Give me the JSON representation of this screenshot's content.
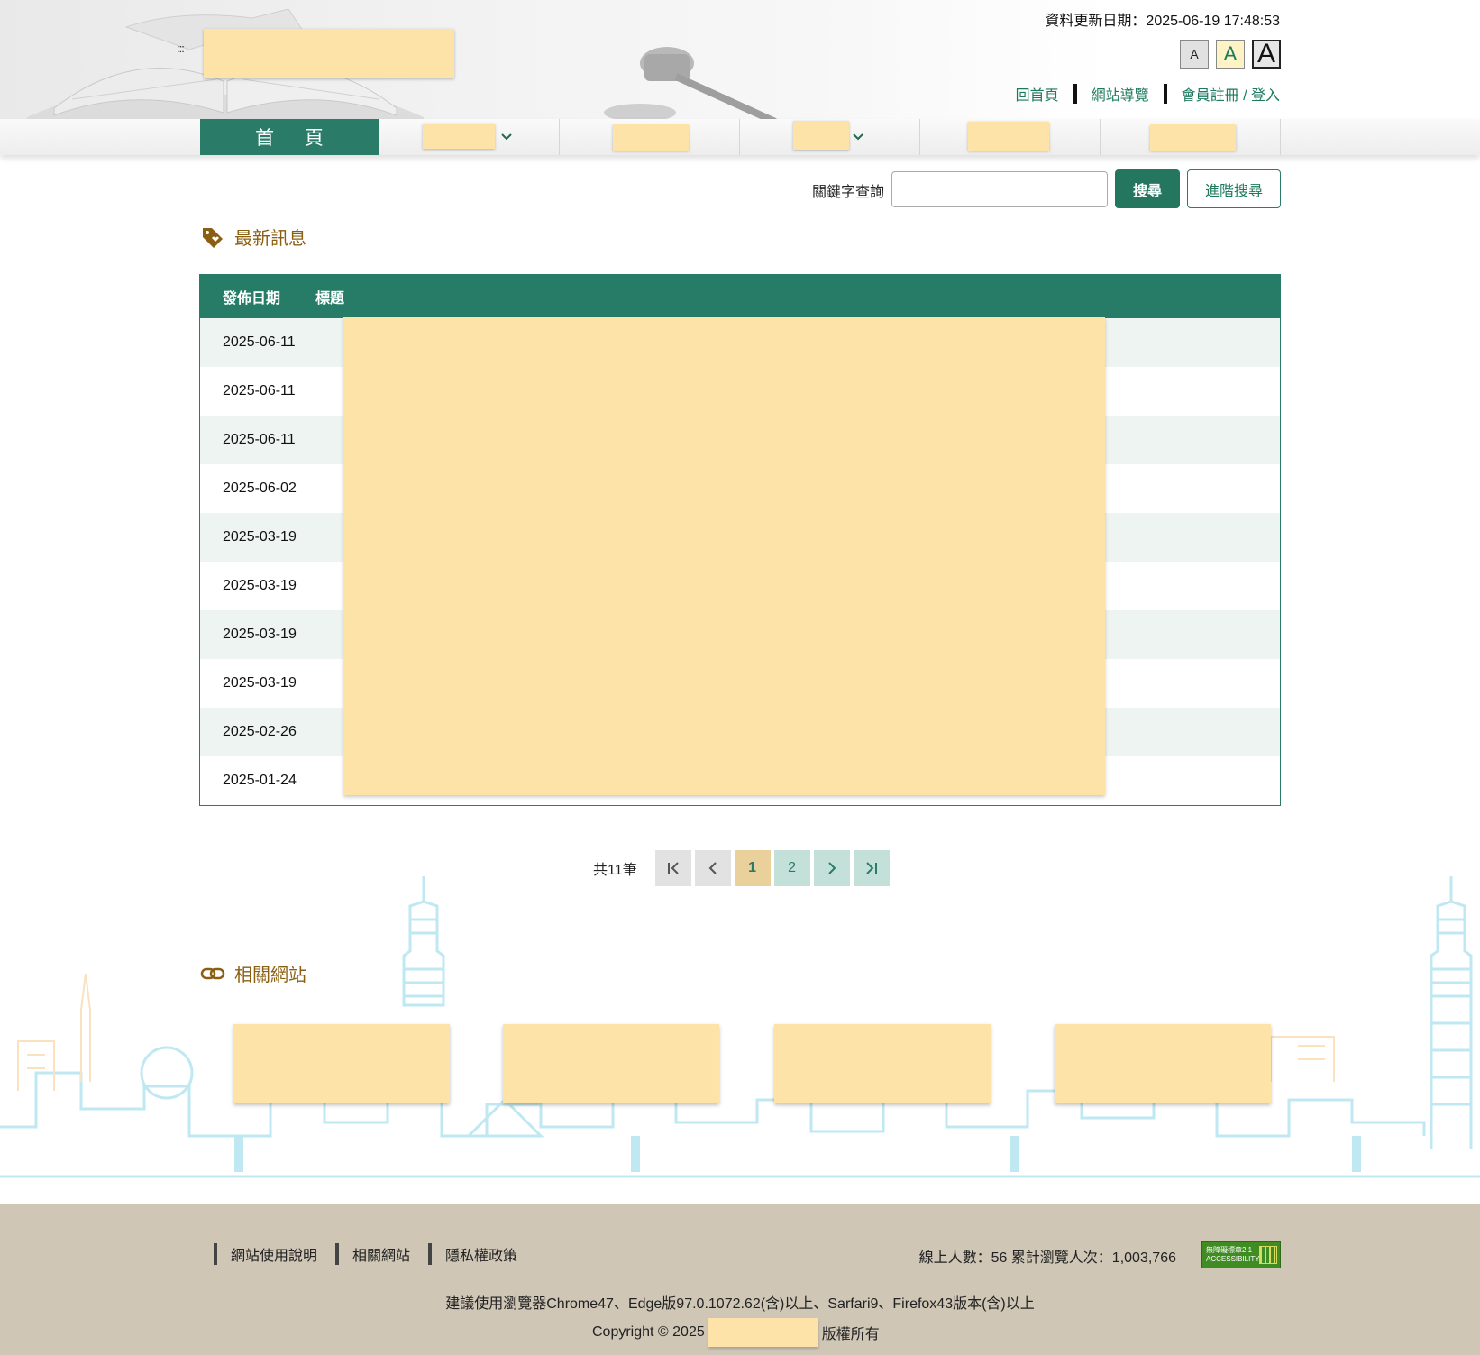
{
  "header": {
    "access_key": ":::",
    "update_info": "資料更新日期：2025-06-19 17:48:53",
    "font_sizes": [
      "A",
      "A",
      "A"
    ],
    "links": [
      "回首頁",
      "網站導覽",
      "會員註冊 / 登入"
    ]
  },
  "nav": {
    "home": "首 頁"
  },
  "search": {
    "label": "關鍵字查詢",
    "value": "",
    "button": "搜尋",
    "advanced": "進階搜尋"
  },
  "news": {
    "heading": "最新訊息",
    "columns": [
      "發佈日期",
      "標題"
    ],
    "dates": [
      "2025-06-11",
      "2025-06-11",
      "2025-06-11",
      "2025-06-02",
      "2025-03-19",
      "2025-03-19",
      "2025-03-19",
      "2025-03-19",
      "2025-02-26",
      "2025-01-24"
    ]
  },
  "pager": {
    "count": "共11筆",
    "pages": [
      "1",
      "2"
    ],
    "current": "1"
  },
  "related": {
    "heading": "相關網站"
  },
  "footer": {
    "links": [
      "網站使用說明",
      "相關網站",
      "隱私權政策"
    ],
    "counter": "線上人數：56  累計瀏覽人次：1,003,766",
    "a11y_badge": "無障礙標章2.1 ACCESSIBILITY",
    "browser_note": "建議使用瀏覽器Chrome47、Edge版97.0.1072.62(含)以上、Sarfari9、Firefox43版本(含)以上",
    "copyright_prefix": "Copyright © 2025",
    "copyright_suffix": "版權所有"
  },
  "colors": {
    "brand_green": "#267c67",
    "accent_gold": "#8b5f12",
    "redaction": "#fde3a7",
    "footer_bg": "#cfc6b6"
  }
}
